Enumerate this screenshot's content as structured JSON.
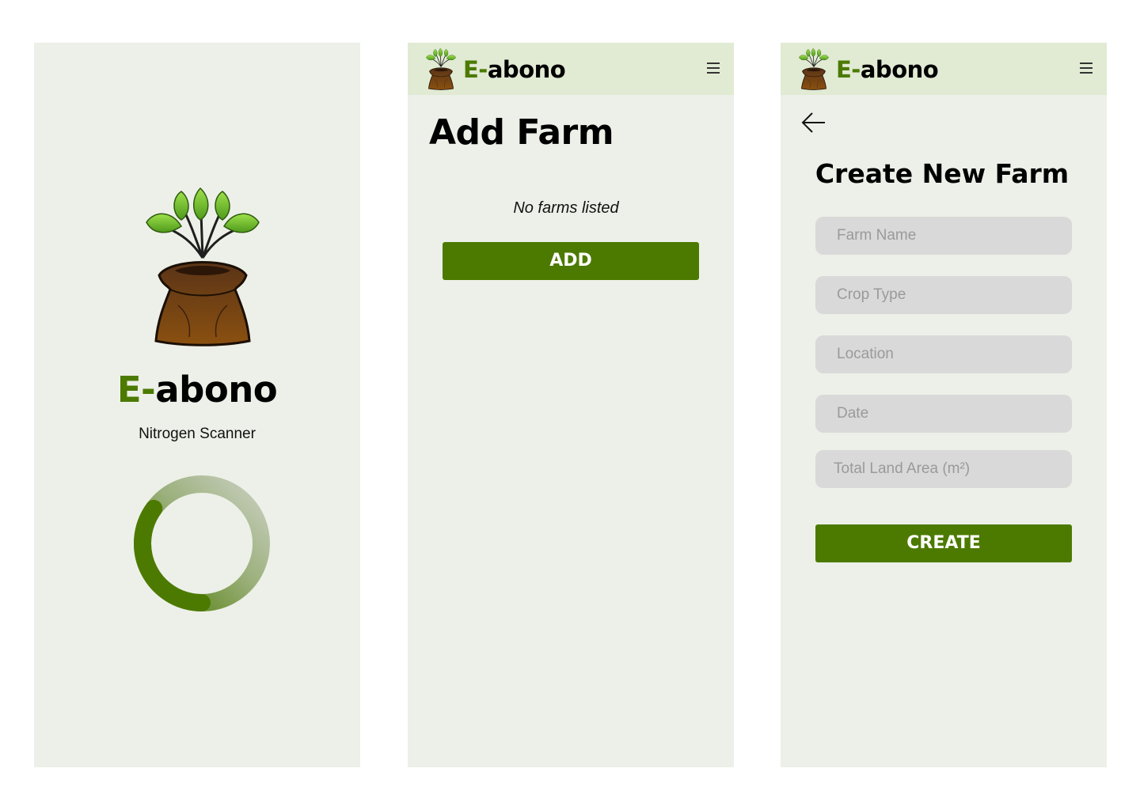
{
  "brand": {
    "prefix": "E-",
    "suffix": "abono"
  },
  "splash": {
    "subtitle": "Nitrogen Scanner",
    "progress_fraction": 0.35
  },
  "add_farm": {
    "title": "Add Farm",
    "empty_message": "No farms listed",
    "add_label": "ADD"
  },
  "create_farm": {
    "title": "Create New Farm",
    "fields": [
      {
        "placeholder": "Farm Name",
        "value": ""
      },
      {
        "placeholder": "Crop Type",
        "value": ""
      },
      {
        "placeholder": "Location",
        "value": ""
      },
      {
        "placeholder": "Date",
        "value": ""
      },
      {
        "placeholder": "Total Land Area (m²)",
        "value": ""
      }
    ],
    "create_label": "CREATE"
  },
  "colors": {
    "primary": "#4c7a00",
    "screen_bg": "#edf0e8",
    "header_bg": "#e1ead3",
    "field_bg": "#d9d9d9"
  },
  "icons": [
    "logo-sprout-bag-icon",
    "hamburger-menu-icon",
    "back-arrow-icon",
    "loading-spinner-icon"
  ]
}
